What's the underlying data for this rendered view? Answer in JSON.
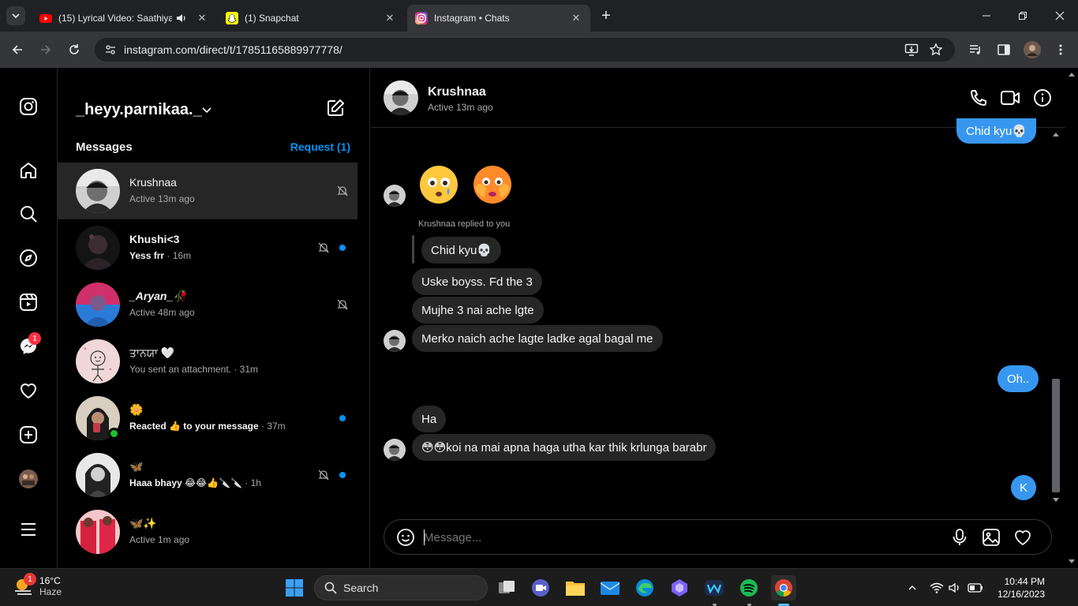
{
  "browser": {
    "tabs": [
      {
        "title": "(15) Lyrical Video: Saathiya",
        "icon": "youtube-icon"
      },
      {
        "title": "(1) Snapchat",
        "icon": "snapchat-icon"
      },
      {
        "title": "Instagram • Chats",
        "icon": "instagram-icon"
      }
    ],
    "url": "instagram.com/direct/t/17851165889977778/"
  },
  "sidebar": {
    "notification_badge": "1",
    "items": [
      "instagram-logo-icon",
      "home-icon",
      "search-icon",
      "explore-icon",
      "reels-icon",
      "messenger-icon",
      "heart-icon",
      "create-icon",
      "profile-icon",
      "menu-icon"
    ]
  },
  "inbox": {
    "username": "_heyy.parnikaa._",
    "messages_label": "Messages",
    "request_label": "Request (1)",
    "conversations": [
      {
        "name": "Krushnaa",
        "sub": "Active 13m ago",
        "time": ""
      },
      {
        "name": "Khushi<3",
        "sub": "Yess frr",
        "time": " · 16m"
      },
      {
        "name": "_Aryan_🥀",
        "sub": "Active 48m ago",
        "time": ""
      },
      {
        "name": "ਤਾਨਯਾ 🤍",
        "sub": "You sent an attachment.",
        "time": " · 31m"
      },
      {
        "name": "🌼",
        "sub": "Reacted 👍 to your message",
        "time": " · 37m"
      },
      {
        "name": "🦋",
        "sub": "Haaa bhayy 😂😂👍🔪🔪",
        "time": " · 1h"
      },
      {
        "name": "🦋✨",
        "sub": "Active 1m ago",
        "time": ""
      }
    ]
  },
  "chat": {
    "name": "Krushnaa",
    "status": "Active 13m ago",
    "messages": {
      "out_top": "Chid kyu💀",
      "replied_label": "Krushnaa replied to you",
      "quoted": "Chid kyu💀",
      "in1": "Uske boyss. Fd the 3",
      "in2": "Mujhe 3 nai ache lgte",
      "in3": "Merko naich ache lagte ladke agal bagal me",
      "out1": "Oh..",
      "in4": "Ha",
      "in5": "😳😳koi na mai apna haga utha kar thik krlunga barabr",
      "seen_avatar": "K"
    },
    "composer_placeholder": "Message..."
  },
  "taskbar": {
    "temperature": "16°C",
    "condition": "Haze",
    "weather_badge": "1",
    "search_label": "Search",
    "time": "10:44 PM",
    "date": "12/16/2023"
  }
}
